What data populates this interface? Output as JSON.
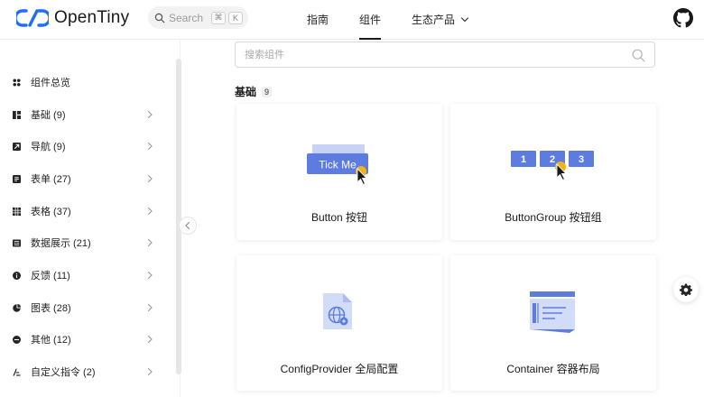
{
  "header": {
    "logo_text": "OpenTiny",
    "search_placeholder": "Search",
    "kbd_cmd": "⌘",
    "kbd_k": "K",
    "nav": [
      {
        "label": "指南",
        "active": false
      },
      {
        "label": "组件",
        "active": true
      },
      {
        "label": "生态产品",
        "active": false
      }
    ]
  },
  "sidebar": {
    "items": [
      {
        "label": "组件总览",
        "icon": "grid-icon"
      },
      {
        "label": "基础 (9)",
        "icon": "layout-icon"
      },
      {
        "label": "导航 (9)",
        "icon": "navigation-icon"
      },
      {
        "label": "表单 (27)",
        "icon": "form-icon"
      },
      {
        "label": "表格 (37)",
        "icon": "table-icon"
      },
      {
        "label": "数据展示 (21)",
        "icon": "data-display-icon"
      },
      {
        "label": "反馈 (11)",
        "icon": "info-icon"
      },
      {
        "label": "图表 (28)",
        "icon": "pie-chart-icon"
      },
      {
        "label": "其他 (12)",
        "icon": "more-icon"
      },
      {
        "label": "自定义指令 (2)",
        "icon": "directive-icon"
      }
    ]
  },
  "main": {
    "search_placeholder": "搜索组件",
    "section_title": "基础",
    "section_count": "9",
    "cards": [
      {
        "label": "Button 按钮",
        "preview_text": "Tick Me"
      },
      {
        "label": "ButtonGroup 按钮组",
        "preview_items": [
          "1",
          "2",
          "3"
        ]
      },
      {
        "label": "ConfigProvider 全局配置"
      },
      {
        "label": "Container 容器布局"
      }
    ]
  },
  "colors": {
    "accent": "#5e7ce0",
    "accent_light": "#c7d2f5",
    "cursor_dot": "#f2b21b"
  }
}
